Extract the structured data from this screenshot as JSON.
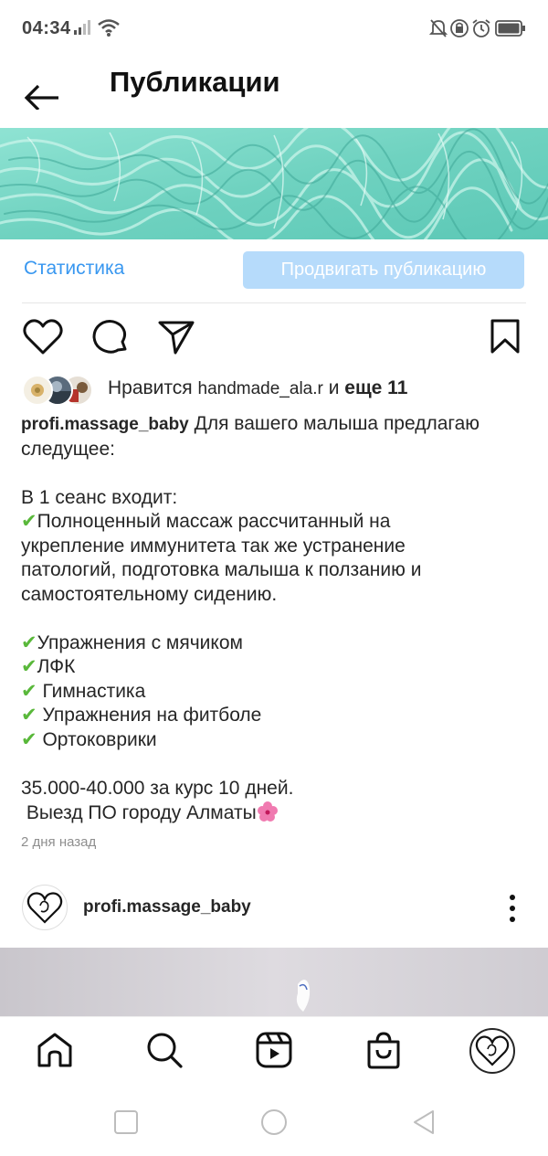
{
  "status_bar": {
    "time": "04:34",
    "left_icons": [
      "signal-icon",
      "wifi-icon"
    ],
    "right_icons": [
      "mute-icon",
      "data-saver-icon",
      "alarm-icon",
      "battery-icon"
    ]
  },
  "header": {
    "title": "Публикации",
    "back_icon": "back-arrow-icon"
  },
  "stats": {
    "statistics_label": "Статистика",
    "promote_label": "Продвигать публикацию"
  },
  "actions": [
    "heart-icon",
    "comment-icon",
    "share-icon",
    "bookmark-icon"
  ],
  "likes": {
    "prefix": "Нравится",
    "user": "handmade_ala.r",
    "connector": "и",
    "others": "еще 11"
  },
  "caption": {
    "author": "profi.massage_baby",
    "first_line": "Для вашего малыша предлагаю",
    "lines": [
      "следущее:",
      "",
      "В 1 сеанс входит:",
      "Полноценный массаж рассчитанный на",
      "укрепление иммунитета так же устранение",
      "патологий, подготовка малыша к ползанию и",
      "самостоятельному сидению.",
      "",
      "Упражнения с мячиком",
      "ЛФК",
      " Гимнастика",
      " Упражнения на фитболе",
      " Ортоковрики",
      "",
      "35.000-40.000 за курс 10 дней.",
      " Выезд ПО городу Алматы"
    ]
  },
  "post_time": "2 дня назад",
  "next_post": {
    "username": "profi.massage_baby"
  },
  "bottom_nav": [
    "home-icon",
    "search-icon",
    "reels-icon",
    "shop-icon",
    "profile-avatar"
  ],
  "colors": {
    "link_blue": "#3897f0",
    "promote_bg": "#b6dbfb",
    "check_green": "#59b83a",
    "cover_teal": "#7ed9c9"
  }
}
